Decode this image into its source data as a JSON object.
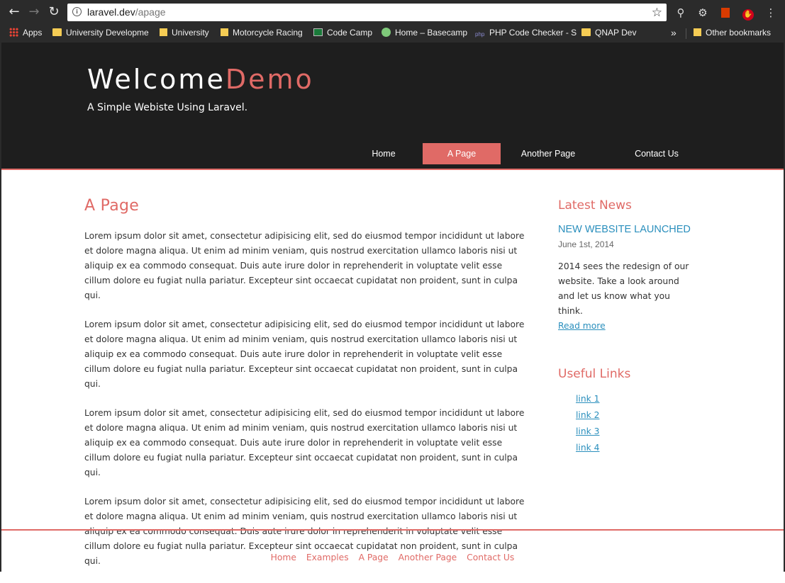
{
  "browser": {
    "url_host": "laravel.dev",
    "url_path": "/apage",
    "bookmarks": [
      {
        "label": "Apps",
        "icon": "apps-grid-icon"
      },
      {
        "label": "University Developme",
        "icon": "folder-icon"
      },
      {
        "label": "University",
        "icon": "page-icon"
      },
      {
        "label": "Motorcycle Racing",
        "icon": "page-icon"
      },
      {
        "label": "Code Camp",
        "icon": "code-camp-icon"
      },
      {
        "label": "Home – Basecamp",
        "icon": "basecamp-icon"
      },
      {
        "label": "PHP Code Checker - S",
        "icon": "php-icon"
      },
      {
        "label": "QNAP  Dev",
        "icon": "folder-icon"
      }
    ],
    "overflow": "»",
    "other_bookmarks": "Other bookmarks"
  },
  "site": {
    "logo_main": "Welcome",
    "logo_accent": "Demo",
    "tagline": "A Simple Webiste Using Laravel.",
    "menu": [
      {
        "label": "Home",
        "active": false
      },
      {
        "label": "A Page",
        "active": true
      },
      {
        "label": "Another Page",
        "active": false
      },
      {
        "label": "Contact Us",
        "active": false
      }
    ],
    "accent_color": "#e06a66",
    "link_color": "#2a8fbd",
    "header_bg": "#1e1e1e"
  },
  "main": {
    "title": "A Page",
    "paragraphs": [
      "Lorem ipsum dolor sit amet, consectetur adipisicing elit, sed do eiusmod tempor incididunt ut labore et dolore magna aliqua. Ut enim ad minim veniam, quis nostrud exercitation ullamco laboris nisi ut aliquip ex ea commodo consequat. Duis aute irure dolor in reprehenderit in voluptate velit esse cillum dolore eu fugiat nulla pariatur. Excepteur sint occaecat cupidatat non proident, sunt in culpa qui.",
      "Lorem ipsum dolor sit amet, consectetur adipisicing elit, sed do eiusmod tempor incididunt ut labore et dolore magna aliqua. Ut enim ad minim veniam, quis nostrud exercitation ullamco laboris nisi ut aliquip ex ea commodo consequat. Duis aute irure dolor in reprehenderit in voluptate velit esse cillum dolore eu fugiat nulla pariatur. Excepteur sint occaecat cupidatat non proident, sunt in culpa qui.",
      "Lorem ipsum dolor sit amet, consectetur adipisicing elit, sed do eiusmod tempor incididunt ut labore et dolore magna aliqua. Ut enim ad minim veniam, quis nostrud exercitation ullamco laboris nisi ut aliquip ex ea commodo consequat. Duis aute irure dolor in reprehenderit in voluptate velit esse cillum dolore eu fugiat nulla pariatur. Excepteur sint occaecat cupidatat non proident, sunt in culpa qui.",
      "Lorem ipsum dolor sit amet, consectetur adipisicing elit, sed do eiusmod tempor incididunt ut labore et dolore magna aliqua. Ut enim ad minim veniam, quis nostrud exercitation ullamco laboris nisi ut aliquip ex ea commodo consequat. Duis aute irure dolor in reprehenderit in voluptate velit esse cillum dolore eu fugiat nulla pariatur. Excepteur sint occaecat cupidatat non proident, sunt in culpa qui."
    ]
  },
  "sidebar": {
    "news_heading": "Latest News",
    "news_title": "NEW WEBSITE LAUNCHED",
    "news_date": "June 1st, 2014",
    "news_body": "2014 sees the redesign of our website. Take a look around and let us know what you think.",
    "read_more": "Read more",
    "links_heading": "Useful Links",
    "links": [
      "link 1",
      "link 2",
      "link 3",
      "link 4"
    ]
  },
  "footer": {
    "links": [
      "Home",
      "Examples",
      "A Page",
      "Another Page",
      "Contact Us"
    ]
  }
}
